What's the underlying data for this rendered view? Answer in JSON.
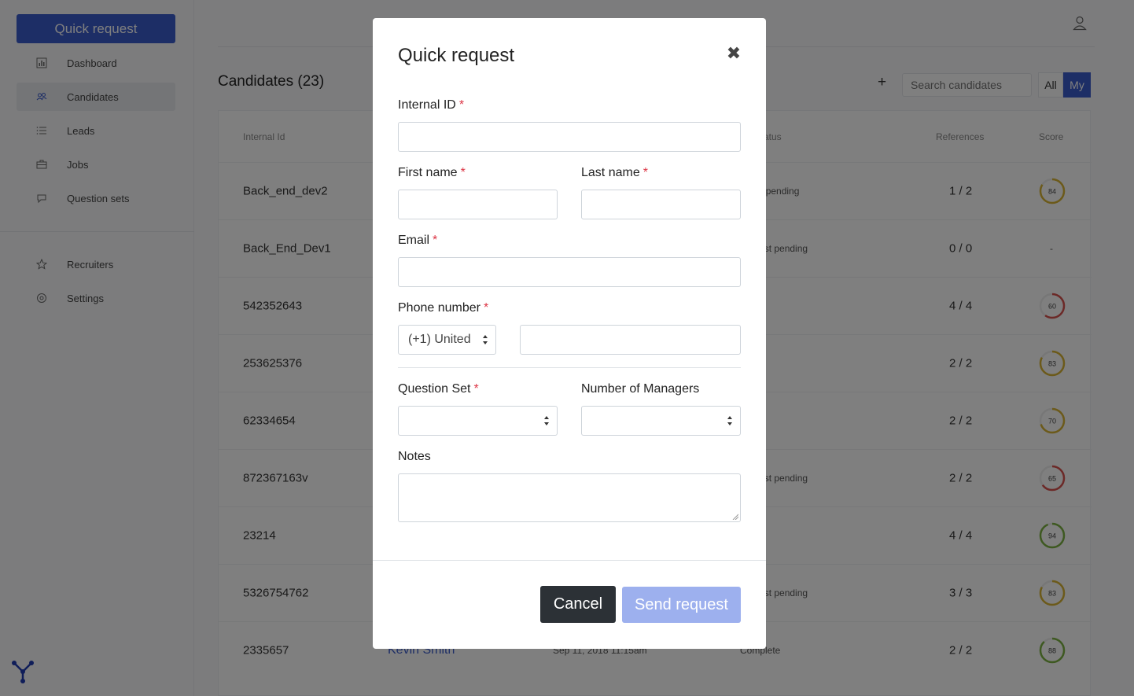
{
  "sidebar": {
    "quick_request_label": "Quick request",
    "items": [
      {
        "label": "Dashboard",
        "icon": "bar-chart-icon"
      },
      {
        "label": "Candidates",
        "icon": "users-icon"
      },
      {
        "label": "Leads",
        "icon": "list-icon"
      },
      {
        "label": "Jobs",
        "icon": "briefcase-icon"
      },
      {
        "label": "Question sets",
        "icon": "speech-bubble-icon"
      },
      {
        "label": "Recruiters",
        "icon": "star-icon"
      },
      {
        "label": "Settings",
        "icon": "gear-icon"
      }
    ]
  },
  "main": {
    "title": "Candidates (23)",
    "add_symbol": "+",
    "search_placeholder": "Search candidates",
    "toggle_all": "All",
    "toggle_my": "My",
    "columns": [
      "Internal Id",
      "atus",
      "References",
      "Score"
    ],
    "rows": [
      {
        "id": "Back_end_dev2",
        "name": "",
        "date": "",
        "status": "quest pending",
        "refs": "1 / 2",
        "score": "84",
        "score_value": 84,
        "color": "#d9b534"
      },
      {
        "id": "Back_End_Dev1",
        "name": "",
        "date": "",
        "status": "request pending",
        "refs": "0 / 0",
        "score": "-",
        "score_value": 0,
        "color": ""
      },
      {
        "id": "542352643",
        "name": "",
        "date": "",
        "status": "",
        "refs": "4 / 4",
        "score": "60",
        "score_value": 60,
        "color": "#d9534f"
      },
      {
        "id": "253625376",
        "name": "",
        "date": "",
        "status": "",
        "refs": "2 / 2",
        "score": "83",
        "score_value": 83,
        "color": "#d9b534"
      },
      {
        "id": "62334654",
        "name": "",
        "date": "",
        "status": "",
        "refs": "2 / 2",
        "score": "70",
        "score_value": 70,
        "color": "#d9b534"
      },
      {
        "id": "872367163v",
        "name": "",
        "date": "",
        "status": "request pending",
        "refs": "2 / 2",
        "score": "65",
        "score_value": 65,
        "color": "#d9534f"
      },
      {
        "id": "23214",
        "name": "",
        "date": "",
        "status": "",
        "refs": "4 / 4",
        "score": "94",
        "score_value": 94,
        "color": "#7cb342"
      },
      {
        "id": "5326754762",
        "name": "",
        "date": "",
        "status": "request pending",
        "refs": "3 / 3",
        "score": "83",
        "score_value": 83,
        "color": "#d9b534"
      },
      {
        "id": "2335657",
        "name": "Kevin Smith",
        "date": "Sep 11, 2018 11:15am",
        "status": "Complete",
        "refs": "2 / 2",
        "score": "88",
        "score_value": 88,
        "color": "#7cb342"
      }
    ]
  },
  "modal": {
    "title": "Quick request",
    "close_symbol": "✖",
    "required_mark": "*",
    "internal_id_label": "Internal ID",
    "first_name_label": "First name",
    "last_name_label": "Last name",
    "email_label": "Email",
    "phone_label": "Phone number",
    "country_code_value": "(+1) United",
    "question_set_label": "Question Set",
    "managers_label": "Number of Managers",
    "notes_label": "Notes",
    "cancel_label": "Cancel",
    "send_label": "Send request"
  },
  "colors": {
    "primary": "#3b5ccc",
    "primary_disabled": "#9db0ee",
    "dark": "#2c3136",
    "required": "#dc3545"
  }
}
